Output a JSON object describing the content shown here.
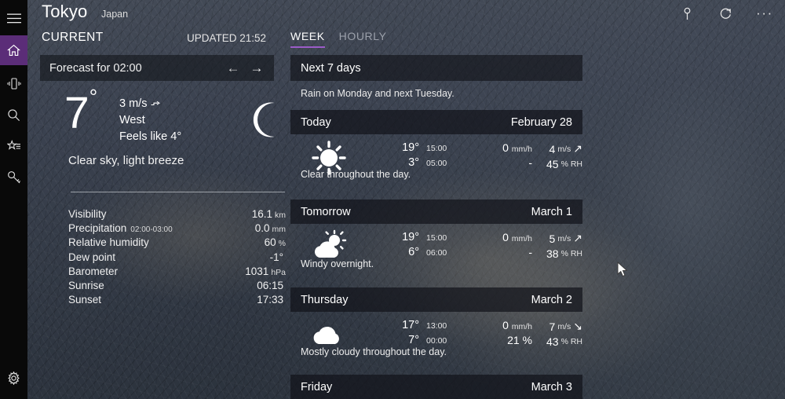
{
  "sidebar": {
    "items": [
      {
        "name": "menu",
        "icon": "hamburger-icon"
      },
      {
        "name": "home",
        "icon": "home-icon",
        "active": true
      },
      {
        "name": "devices",
        "icon": "device-vibrate-icon"
      },
      {
        "name": "search",
        "icon": "search-icon"
      },
      {
        "name": "favorites",
        "icon": "star-list-icon"
      },
      {
        "name": "keys",
        "icon": "key-icon"
      }
    ],
    "settings": {
      "name": "settings",
      "icon": "gear-icon"
    },
    "active_color": "#5b2d78"
  },
  "titlebar": {
    "city": "Tokyo",
    "country": "Japan",
    "pin_icon": "pin-icon",
    "refresh_icon": "refresh-icon",
    "more_label": "···"
  },
  "current": {
    "section_label": "CURRENT",
    "updated_label": "UPDATED 21:52",
    "forecast_for": "Forecast for 02:00",
    "prev_arrow": "←",
    "next_arrow": "→",
    "temperature": "7",
    "degree": "°",
    "wind_speed": "3 m/s",
    "wind_direction": "West",
    "feels_like": "Feels like 4°",
    "condition_icon": "moon-icon",
    "summary": "Clear sky, light breeze",
    "details": [
      {
        "label": "Visibility",
        "sub": "",
        "value": "16.1",
        "unit": "km"
      },
      {
        "label": "Precipitation",
        "sub": "02:00-03:00",
        "value": "0.0",
        "unit": "mm"
      },
      {
        "label": "Relative humidity",
        "sub": "",
        "value": "60",
        "unit": "%"
      },
      {
        "label": "Dew point",
        "sub": "",
        "value": "-1°",
        "unit": ""
      },
      {
        "label": "Barometer",
        "sub": "",
        "value": "1031",
        "unit": "hPa"
      },
      {
        "label": "Sunrise",
        "sub": "",
        "value": "06:15",
        "unit": ""
      },
      {
        "label": "Sunset",
        "sub": "",
        "value": "17:33",
        "unit": ""
      }
    ]
  },
  "forecast": {
    "tabs": [
      {
        "label": "WEEK",
        "active": true
      },
      {
        "label": "HOURLY",
        "active": false
      }
    ],
    "accent_color": "#9b5cc8",
    "header_bar": "Next 7 days",
    "note": "Rain on Monday and next Tuesday.",
    "days": [
      {
        "name": "Today",
        "date": "February 28",
        "icon": "sun-icon",
        "high": "19°",
        "high_time": "15:00",
        "low": "3°",
        "low_time": "05:00",
        "precip_amount": "0",
        "precip_unit": "mm/h",
        "precip_chance": "-",
        "wind": "4",
        "wind_unit": "m/s",
        "wind_arrow": "↗",
        "humidity": "45",
        "humidity_unit": "% RH",
        "description": "Clear throughout the day."
      },
      {
        "name": "Tomorrow",
        "date": "March 1",
        "icon": "partly-cloudy-icon",
        "high": "19°",
        "high_time": "15:00",
        "low": "6°",
        "low_time": "06:00",
        "precip_amount": "0",
        "precip_unit": "mm/h",
        "precip_chance": "-",
        "wind": "5",
        "wind_unit": "m/s",
        "wind_arrow": "↗",
        "humidity": "38",
        "humidity_unit": "% RH",
        "description": "Windy overnight."
      },
      {
        "name": "Thursday",
        "date": "March 2",
        "icon": "cloud-icon",
        "high": "17°",
        "high_time": "13:00",
        "low": "7°",
        "low_time": "00:00",
        "precip_amount": "0",
        "precip_unit": "mm/h",
        "precip_chance": "21 %",
        "wind": "7",
        "wind_unit": "m/s",
        "wind_arrow": "↘",
        "humidity": "43",
        "humidity_unit": "% RH",
        "description": "Mostly cloudy throughout the day."
      },
      {
        "name": "Friday",
        "date": "March 3",
        "icon": "",
        "high": "",
        "high_time": "",
        "low": "",
        "low_time": "",
        "precip_amount": "",
        "precip_unit": "",
        "precip_chance": "",
        "wind": "",
        "wind_unit": "",
        "wind_arrow": "",
        "humidity": "",
        "humidity_unit": "",
        "description": ""
      }
    ]
  },
  "cursor": {
    "icon": "mouse-pointer"
  }
}
